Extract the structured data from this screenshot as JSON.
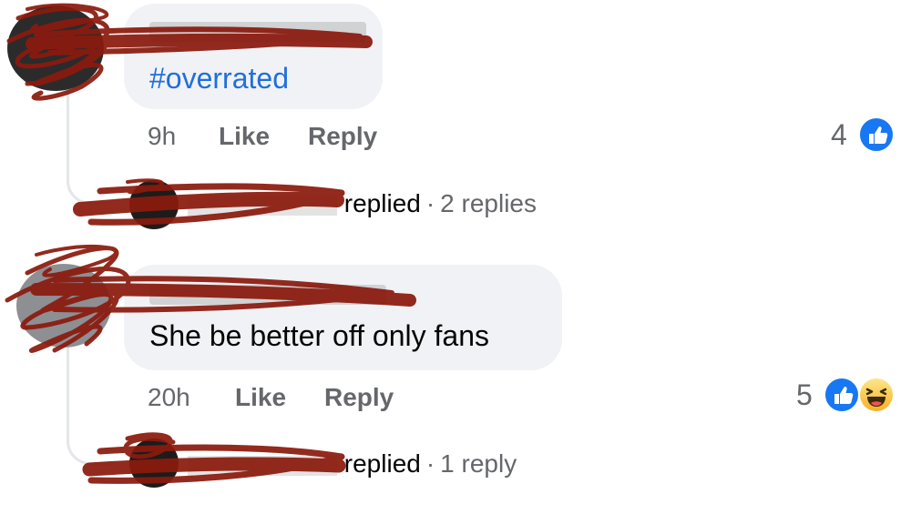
{
  "comments": [
    {
      "text": "#overrated",
      "time": "9h",
      "like_label": "Like",
      "reply_label": "Reply",
      "reaction_count": "4",
      "reactions": [
        "like-icon"
      ],
      "replied_label": "replied",
      "replies_count": "2 replies"
    },
    {
      "text": "She be better off only fans",
      "time": "20h",
      "like_label": "Like",
      "reply_label": "Reply",
      "reaction_count": "5",
      "reactions": [
        "like-icon",
        "haha-icon"
      ],
      "replied_label": "replied",
      "replies_count": "1 reply"
    }
  ],
  "colors": {
    "bubble": "#f0f2f5",
    "hashtag": "#216fdb",
    "meta": "#65676b",
    "like_blue": "#1877f2",
    "redaction": "#8b1a0e"
  }
}
